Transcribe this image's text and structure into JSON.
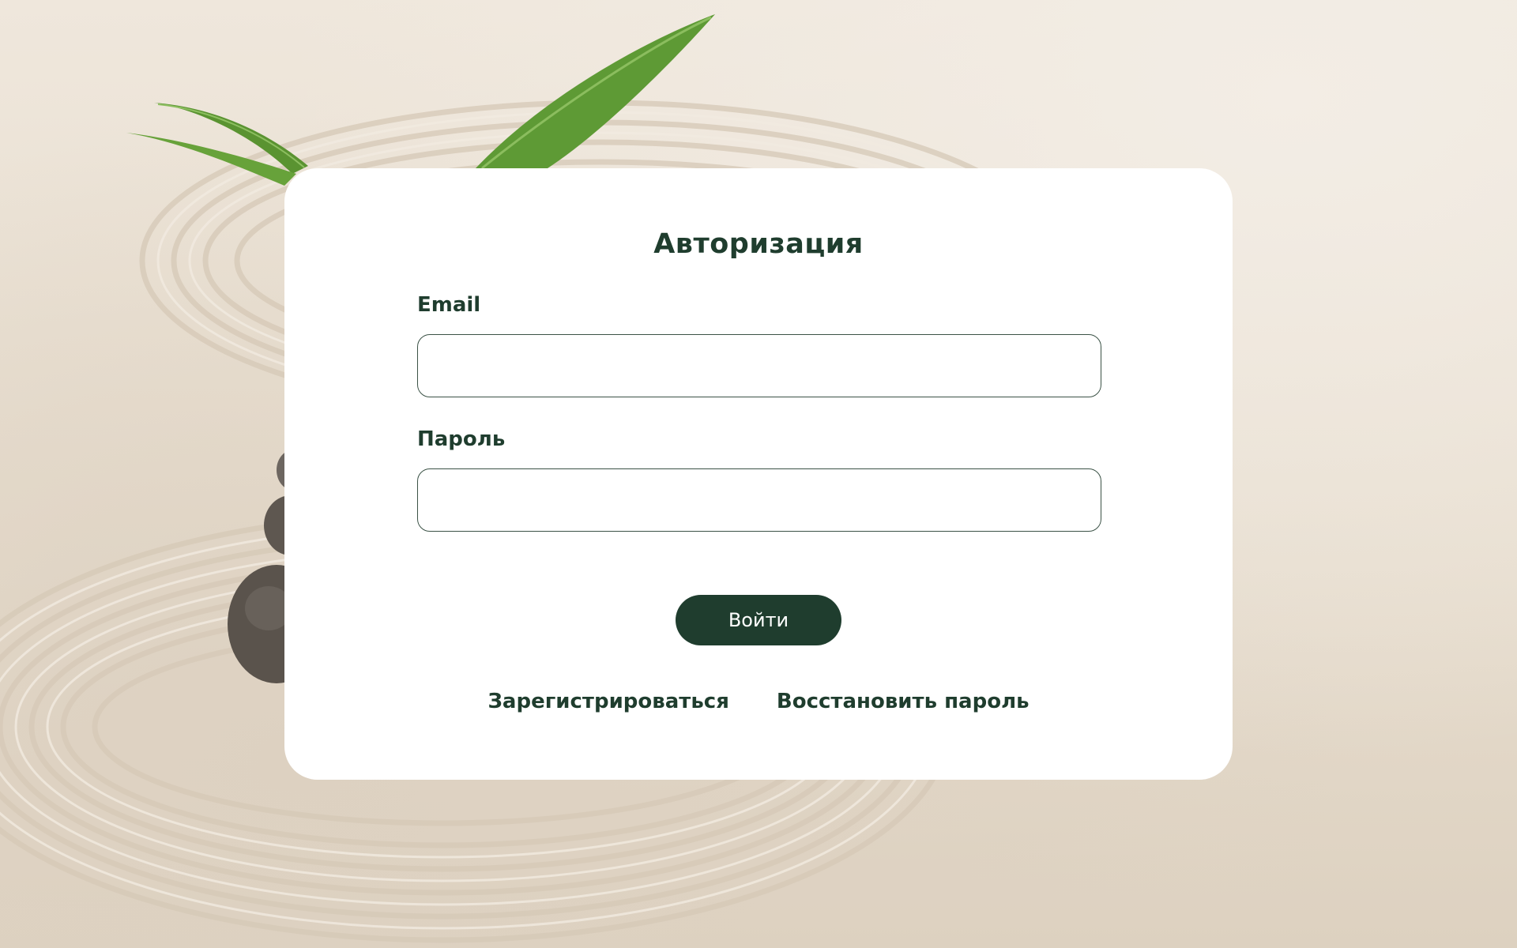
{
  "auth": {
    "title": "Авторизация",
    "email_label": "Email",
    "email_value": "",
    "password_label": "Пароль",
    "password_value": "",
    "submit_label": "Войти",
    "register_link": "Зарегистрироваться",
    "restore_link": "Восстановить пароль"
  },
  "colors": {
    "accent": "#1f3d2e",
    "card": "#ffffff",
    "background": "#e9e0d3"
  },
  "background": {
    "icons": [
      "bamboo-leaf-icon",
      "stacked-stones-icon",
      "sand-ripples-icon"
    ]
  }
}
